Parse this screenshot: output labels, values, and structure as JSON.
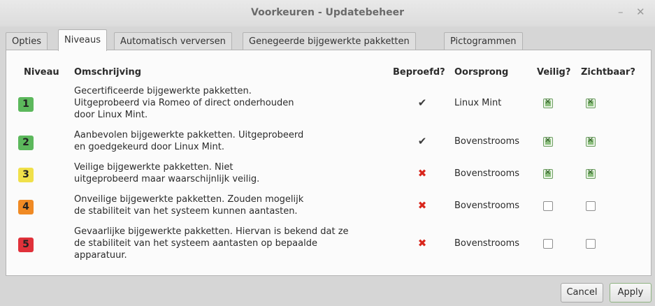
{
  "window": {
    "title": "Voorkeuren - Updatebeheer",
    "minimize_glyph": "–",
    "close_glyph": "✕"
  },
  "tabs": [
    {
      "label": "Opties",
      "active": false
    },
    {
      "label": "Niveaus",
      "active": true
    },
    {
      "label": "Automatisch verversen",
      "active": false
    },
    {
      "label": "Genegeerde bijgewerkte pakketten",
      "active": false
    },
    {
      "label": "Pictogrammen",
      "active": false
    }
  ],
  "table": {
    "headers": {
      "level": "Niveau",
      "description": "Omschrijving",
      "tested": "Beproefd?",
      "origin": "Oorsprong",
      "safe": "Veilig?",
      "visible": "Zichtbaar?"
    },
    "rows": [
      {
        "level": "1",
        "level_color": "#5cb85c",
        "description": [
          "Gecertificeerde bijgewerkte pakketten.",
          "Uitgeprobeerd via Romeo of direct onderhouden",
          "door Linux Mint."
        ],
        "tested": "✔",
        "tested_color": "#3c3c3c",
        "origin": "Linux Mint",
        "safe": true,
        "visible": true
      },
      {
        "level": "2",
        "level_color": "#5cb85c",
        "description": [
          "Aanbevolen bijgewerkte pakketten. Uitgeprobeerd",
          "en goedgekeurd door Linux Mint."
        ],
        "tested": "✔",
        "tested_color": "#3c3c3c",
        "origin": "Bovenstrooms",
        "safe": true,
        "visible": true
      },
      {
        "level": "3",
        "level_color": "#f0e04a",
        "description": [
          "Veilige bijgewerkte pakketten. Niet",
          "uitgeprobeerd maar waarschijnlijk veilig."
        ],
        "tested": "✖",
        "tested_color": "#d9261c",
        "origin": "Bovenstrooms",
        "safe": true,
        "visible": true
      },
      {
        "level": "4",
        "level_color": "#f08a24",
        "description": [
          "Onveilige bijgewerkte pakketten. Zouden mogelijk",
          "de stabiliteit van het systeem kunnen aantasten."
        ],
        "tested": "✖",
        "tested_color": "#d9261c",
        "origin": "Bovenstrooms",
        "safe": false,
        "visible": false
      },
      {
        "level": "5",
        "level_color": "#e0313a",
        "description": [
          "Gevaarlijke bijgewerkte pakketten. Hiervan is bekend dat ze",
          "de stabiliteit van het systeem aantasten op bepaalde",
          "apparatuur."
        ],
        "tested": "✖",
        "tested_color": "#d9261c",
        "origin": "Bovenstrooms",
        "safe": false,
        "visible": false
      }
    ]
  },
  "buttons": {
    "cancel": "Cancel",
    "apply": "Apply"
  }
}
